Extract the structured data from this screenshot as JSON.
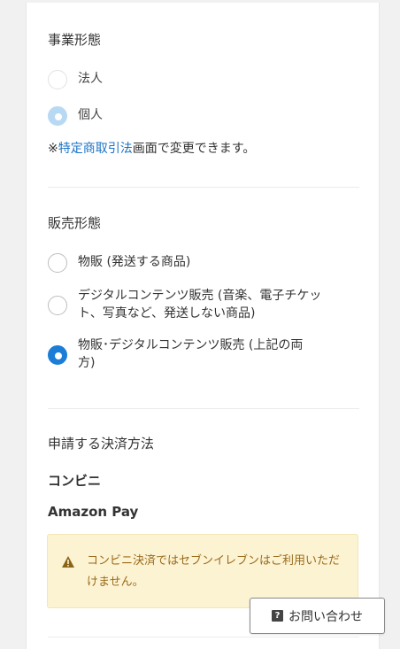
{
  "business_type": {
    "title": "事業形態",
    "options": [
      {
        "label": "法人",
        "state": "disabled"
      },
      {
        "label": "個人",
        "state": "selected-disabled"
      }
    ],
    "note_prefix": "※",
    "note_link": "特定商取引法",
    "note_suffix": "画面で変更できます。"
  },
  "sales_type": {
    "title": "販売形態",
    "options": [
      {
        "label": "物販 (発送する商品)",
        "state": "unselected"
      },
      {
        "label_line1": "デジタルコンテンツ販売 (音楽、電子チケッ",
        "label_line2": "ト、写真など、発送しない商品)",
        "state": "unselected"
      },
      {
        "label_line1": "物販･デジタルコンテンツ販売 (上記の両",
        "label_line2": "方)",
        "state": "selected"
      }
    ]
  },
  "payment": {
    "title": "申請する決済方法",
    "methods": [
      "コンビニ",
      "Amazon Pay"
    ],
    "warning": "コンビニ決済ではセブンイレブンはご利用いただけません。"
  },
  "contact_button": {
    "label": "お問い合わせ",
    "icon": "question-icon"
  },
  "colors": {
    "accent": "#1b7dd6",
    "link": "#1b73c7",
    "warning_bg": "#fcf3d3",
    "warning_text": "#9a6b1c"
  }
}
